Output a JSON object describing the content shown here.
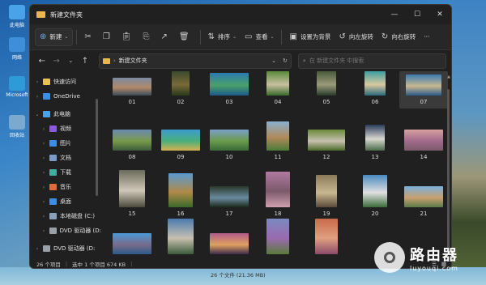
{
  "desktop": {
    "icons": [
      {
        "label": "此电脑",
        "icon": "computer-icon",
        "color": "#4aa3e8"
      },
      {
        "label": "网络",
        "icon": "network-icon",
        "color": "#3c8fd8"
      },
      {
        "label": "Microsoft",
        "icon": "edge-icon",
        "color": "#2f9ad8"
      },
      {
        "label": "回收站",
        "icon": "recycle-bin-icon",
        "color": "#7aaad0"
      }
    ]
  },
  "window": {
    "title": "新建文件夹",
    "controls": {
      "minimize": "—",
      "maximize": "☐",
      "close": "✕"
    }
  },
  "toolbar": {
    "new_label": "新建",
    "sort_label": "排序",
    "view_label": "查看",
    "set_wallpaper_label": "设置为背景",
    "rotate_left_label": "向左旋转",
    "rotate_right_label": "向右旋转",
    "more_label": "···"
  },
  "address": {
    "path": "新建文件夹",
    "search_placeholder": "在 新建文件夹 中搜索"
  },
  "sidebar": {
    "items": [
      {
        "label": "快速访问",
        "icon": "star-icon",
        "color": "#e8c547",
        "indent": 0,
        "expander": "›"
      },
      {
        "label": "OneDrive",
        "icon": "cloud-icon",
        "color": "#3c8fe0",
        "indent": 0,
        "expander": "›"
      },
      {
        "label": "此电脑",
        "icon": "computer-icon",
        "color": "#4aa3e8",
        "indent": 0,
        "expander": "⌄"
      },
      {
        "label": "视频",
        "icon": "video-icon",
        "color": "#8a5ad8",
        "indent": 1,
        "expander": "›"
      },
      {
        "label": "图片",
        "icon": "pictures-icon",
        "color": "#3c8fe0",
        "indent": 1,
        "expander": "›"
      },
      {
        "label": "文档",
        "icon": "documents-icon",
        "color": "#7a9ac8",
        "indent": 1,
        "expander": "›"
      },
      {
        "label": "下载",
        "icon": "download-icon",
        "color": "#3ab0a0",
        "indent": 1,
        "expander": "›"
      },
      {
        "label": "音乐",
        "icon": "music-icon",
        "color": "#e06a3a",
        "indent": 1,
        "expander": "›"
      },
      {
        "label": "桌面",
        "icon": "desktop-icon",
        "color": "#3c8fe0",
        "indent": 1,
        "expander": "›"
      },
      {
        "label": "本地磁盘 (C:)",
        "icon": "drive-icon",
        "color": "#8aa0b8",
        "indent": 1,
        "expander": "›"
      },
      {
        "label": "DVD 驱动器 (D:",
        "icon": "dvd-icon",
        "color": "#9aa0a8",
        "indent": 1,
        "expander": "›"
      },
      {
        "label": "DVD 驱动器 (D:",
        "icon": "dvd-icon",
        "color": "#9aa0a8",
        "indent": 0,
        "expander": "›"
      }
    ]
  },
  "files": [
    {
      "label": "01",
      "colors": [
        "#7a8aa0",
        "#b08a6a",
        "#3a4a5a"
      ]
    },
    {
      "label": "02",
      "colors": [
        "#3a4a2a",
        "#7a6a3a",
        "#2a3a1a"
      ]
    },
    {
      "label": "03",
      "colors": [
        "#2a7ab0",
        "#4aa06a",
        "#1a5a8a"
      ]
    },
    {
      "label": "04",
      "colors": [
        "#5a8a3a",
        "#c8c0a0",
        "#3a6a2a"
      ]
    },
    {
      "label": "05",
      "colors": [
        "#4a5a3a",
        "#9a9a7a",
        "#2a3a2a"
      ]
    },
    {
      "label": "06",
      "colors": [
        "#3aa0a0",
        "#d8c8a0",
        "#2a6a7a"
      ]
    },
    {
      "label": "07",
      "colors": [
        "#3a7ab0",
        "#c8b890",
        "#2a5a8a"
      ]
    },
    {
      "label": "08",
      "colors": [
        "#6a8ab0",
        "#7a9a4a",
        "#3a5a3a"
      ]
    },
    {
      "label": "09",
      "colors": [
        "#3a9ad0",
        "#4ab07a",
        "#d8b050"
      ]
    },
    {
      "label": "10",
      "colors": [
        "#7aa0c8",
        "#6a9a4a",
        "#3a6a3a"
      ]
    },
    {
      "label": "11",
      "colors": [
        "#8ab0d0",
        "#b08a5a",
        "#4a7a3a"
      ]
    },
    {
      "label": "12",
      "colors": [
        "#6a8a3a",
        "#c8c0b0",
        "#4a6a2a"
      ]
    },
    {
      "label": "13",
      "colors": [
        "#2a3a5a",
        "#d8d8d0",
        "#4a6a4a"
      ]
    },
    {
      "label": "14",
      "colors": [
        "#d8a0a0",
        "#a06a8a",
        "#7a5a6a"
      ]
    },
    {
      "label": "15",
      "colors": [
        "#6a6a5a",
        "#d0c8b8",
        "#4a4a3a"
      ]
    },
    {
      "label": "16",
      "colors": [
        "#5a9ad0",
        "#b08a4a",
        "#3a6a2a"
      ]
    },
    {
      "label": "17",
      "colors": [
        "#2a3a2a",
        "#6a8aa0",
        "#1a2a1a"
      ]
    },
    {
      "label": "18",
      "colors": [
        "#b07aa0",
        "#7a5a6a",
        "#d0a0b0"
      ]
    },
    {
      "label": "19",
      "colors": [
        "#8a7a5a",
        "#c8b890",
        "#5a4a3a"
      ]
    },
    {
      "label": "20",
      "colors": [
        "#4a8ac0",
        "#e0e0e0",
        "#3a6a3a"
      ]
    },
    {
      "label": "21",
      "colors": [
        "#7ab0d8",
        "#c8a070",
        "#5a7a4a"
      ]
    },
    {
      "label": "22",
      "colors": [
        "#4a9ad8",
        "#7a6a8a",
        "#2a5a8a"
      ]
    },
    {
      "label": "23",
      "colors": [
        "#4a7ab0",
        "#c8c0b0",
        "#3a5a3a"
      ]
    },
    {
      "label": "24",
      "colors": [
        "#b05a8a",
        "#e0a060",
        "#3a2a4a"
      ]
    },
    {
      "label": "25",
      "colors": [
        "#7a8ac0",
        "#9a6ab0",
        "#5a7a3a"
      ]
    },
    {
      "label": "26",
      "colors": [
        "#c86a4a",
        "#e0a080",
        "#8a4a6a"
      ]
    }
  ],
  "status": {
    "count": "26 个项目",
    "selected": "选中 1 个项目  674 KB",
    "desktop_text": "26 个文件 (21.36 MB)"
  },
  "watermark": {
    "title": "路由器",
    "subtitle": "luyouqi.com"
  }
}
